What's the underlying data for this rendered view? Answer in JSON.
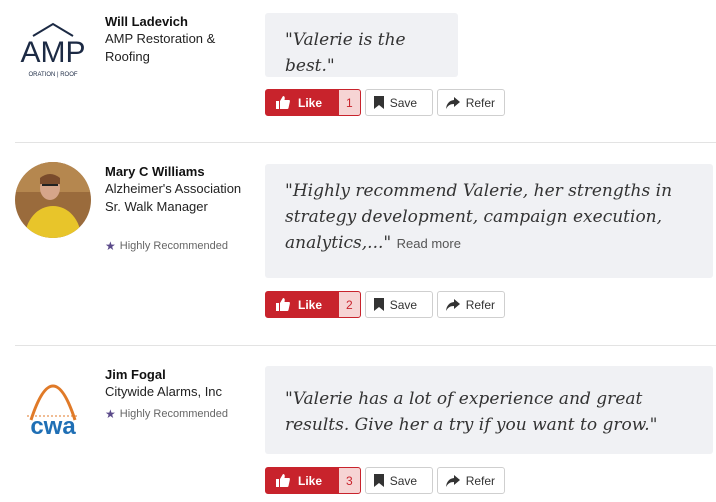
{
  "reviews": [
    {
      "name": "Will Ladevich",
      "company": "AMP Restoration & Roofing",
      "logo_text": "AMP",
      "logo_sub": "ORATION | ROOF",
      "badge": "",
      "quote": "\"Valerie is the best.\"",
      "read_more": "",
      "like_label": "Like",
      "like_count": "1",
      "save_label": "Save",
      "refer_label": "Refer"
    },
    {
      "name": "Mary C Williams",
      "company": "Alzheimer's Association Sr. Walk Manager",
      "badge": "Highly Recommended",
      "quote": "\"Highly recommend Valerie, her strengths in strategy development, campaign execution, analytics,...\"",
      "read_more": "Read more",
      "like_label": "Like",
      "like_count": "2",
      "save_label": "Save",
      "refer_label": "Refer"
    },
    {
      "name": "Jim Fogal",
      "company": "Citywide Alarms, Inc",
      "logo_text": "cwa",
      "badge": "Highly Recommended",
      "quote": "\"Valerie has a lot of experience and great results. Give her a try if you want to grow.\"",
      "read_more": "",
      "like_label": "Like",
      "like_count": "3",
      "save_label": "Save",
      "refer_label": "Refer"
    }
  ],
  "colors": {
    "like_red": "#c8232c",
    "badge_purple": "#5b4a8a",
    "quote_bg": "#f0f1f4"
  },
  "icons": [
    "thumbs-up-icon",
    "bookmark-icon",
    "share-arrow-icon",
    "star-icon"
  ]
}
